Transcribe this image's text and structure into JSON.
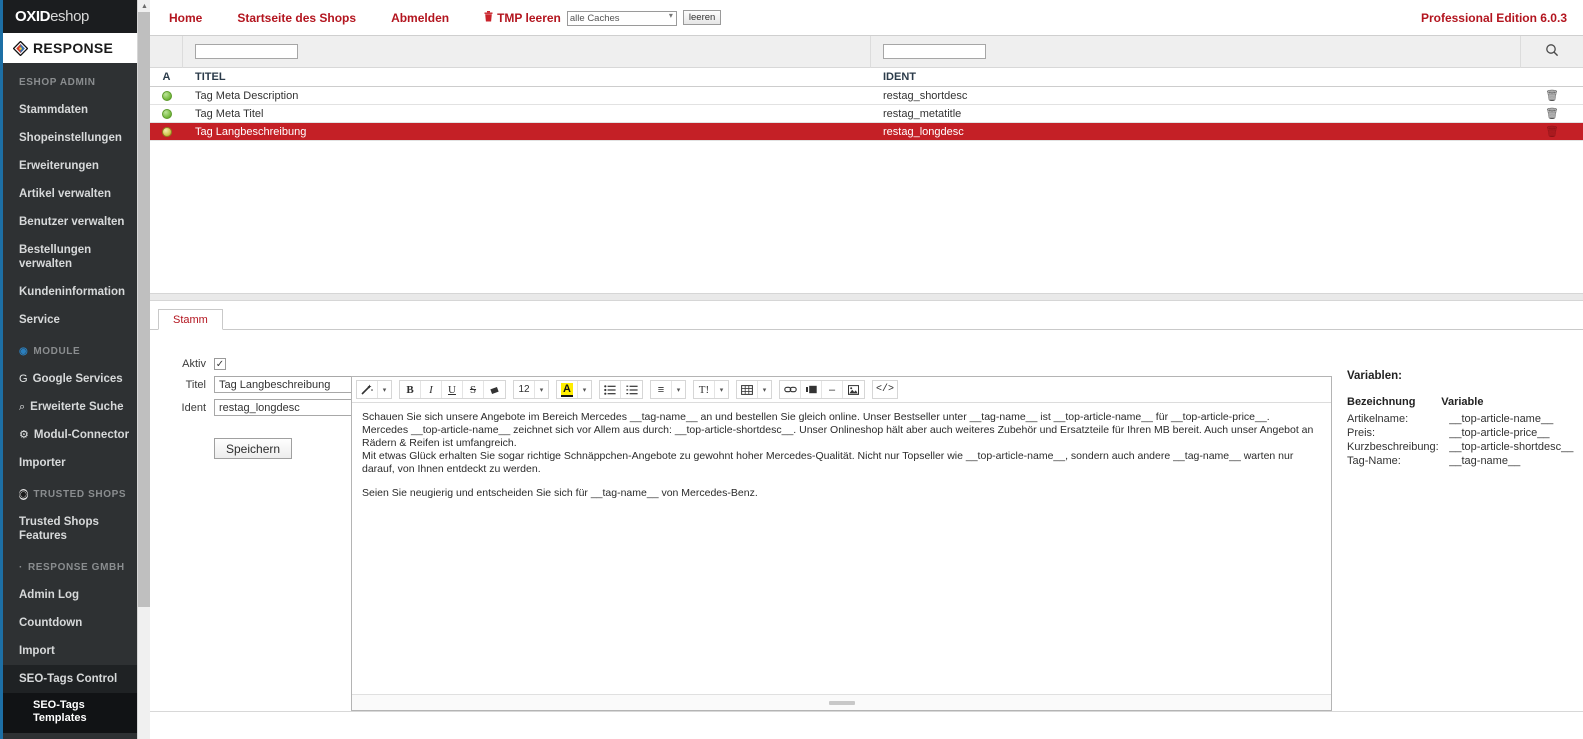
{
  "sidebar": {
    "logo_oxid_bold": "OXID",
    "logo_oxid_light": "eshop",
    "logo_response": "RESPONSE",
    "groups": [
      {
        "label": "ESHOP ADMIN",
        "icon": "",
        "items": [
          {
            "label": "Stammdaten",
            "icon": ""
          },
          {
            "label": "Shopeinstellungen",
            "icon": ""
          },
          {
            "label": "Erweiterungen",
            "icon": ""
          },
          {
            "label": "Artikel verwalten",
            "icon": ""
          },
          {
            "label": "Benutzer verwalten",
            "icon": ""
          },
          {
            "label": "Bestellungen verwalten",
            "icon": ""
          },
          {
            "label": "Kundeninformation",
            "icon": ""
          },
          {
            "label": "Service",
            "icon": ""
          }
        ]
      },
      {
        "label": "MODULE",
        "icon": "◉",
        "items": [
          {
            "label": "Google Services",
            "icon": "G"
          },
          {
            "label": "Erweiterte Suche",
            "icon": "⌕"
          },
          {
            "label": "Modul-Connector",
            "icon": "⚙"
          },
          {
            "label": "Importer",
            "icon": ""
          }
        ]
      },
      {
        "label": "TRUSTED SHOPS",
        "icon": "◉",
        "items": [
          {
            "label": "Trusted Shops Features",
            "icon": ""
          }
        ]
      },
      {
        "label": "RESPONSE GMBH",
        "icon": "·",
        "items": [
          {
            "label": "Admin Log",
            "icon": ""
          },
          {
            "label": "Countdown",
            "icon": ""
          },
          {
            "label": "Import",
            "icon": ""
          },
          {
            "label": "SEO-Tags Control",
            "icon": "",
            "active": true
          }
        ]
      }
    ],
    "sub_item": "SEO-Tags Templates"
  },
  "topbar": {
    "links": [
      "Home",
      "Startseite des Shops",
      "Abmelden"
    ],
    "tmp_label": "TMP leeren",
    "cache_select_value": "alle Caches",
    "clear_button": "leeren",
    "edition": "Professional Edition 6.0.3"
  },
  "list": {
    "filter_titel_value": "",
    "filter_ident_value": "",
    "filter_placeholder": "",
    "search_icon": "search-icon",
    "columns": [
      "A",
      "TITEL",
      "IDENT"
    ],
    "rows": [
      {
        "status": "active",
        "titel": "Tag Meta Description",
        "ident": "restag_shortdesc",
        "selected": false
      },
      {
        "status": "active",
        "titel": "Tag Meta Titel",
        "ident": "restag_metatitle",
        "selected": false
      },
      {
        "status": "active",
        "titel": "Tag Langbeschreibung",
        "ident": "restag_longdesc",
        "selected": true
      }
    ],
    "delete_icon": "🗑"
  },
  "tabs": [
    {
      "label": "Stamm",
      "active": true
    }
  ],
  "form": {
    "aktiv_label": "Aktiv",
    "aktiv_checked": "✓",
    "titel_label": "Titel",
    "titel_value": "Tag Langbeschreibung",
    "ident_label": "Ident",
    "ident_value": "restag_longdesc",
    "save_label": "Speichern"
  },
  "editor": {
    "toolbar_groups": [
      {
        "buttons": [
          {
            "icon": "✨",
            "name": "magic-wand-icon"
          },
          {
            "icon": "▾",
            "name": "chevron-down-icon",
            "caret": true
          }
        ]
      },
      {
        "buttons": [
          {
            "icon": "B",
            "name": "bold-icon",
            "style": "bold-serif"
          },
          {
            "icon": "I",
            "name": "italic-icon",
            "style": "italic-serif"
          },
          {
            "icon": "U",
            "name": "underline-icon",
            "style": "underline-serif"
          },
          {
            "icon": "S",
            "name": "strikethrough-icon",
            "style": "strike-serif"
          },
          {
            "icon": "■",
            "name": "eraser-icon"
          }
        ]
      },
      {
        "buttons": [
          {
            "icon": "12",
            "name": "font-size-selector",
            "style": "size"
          },
          {
            "icon": "▾",
            "name": "chevron-down-icon",
            "caret": true
          }
        ]
      },
      {
        "buttons": [
          {
            "icon": "A",
            "name": "text-color-icon",
            "style": "highlight"
          },
          {
            "icon": "▾",
            "name": "chevron-down-icon",
            "caret": true
          }
        ]
      },
      {
        "buttons": [
          {
            "icon": "☰",
            "name": "unordered-list-icon"
          },
          {
            "icon": "☲",
            "name": "ordered-list-icon"
          }
        ]
      },
      {
        "buttons": [
          {
            "icon": "≡",
            "name": "align-icon"
          },
          {
            "icon": "▾",
            "name": "chevron-down-icon",
            "caret": true
          }
        ]
      },
      {
        "buttons": [
          {
            "icon": "T!",
            "name": "paragraph-style-icon"
          },
          {
            "icon": "▾",
            "name": "chevron-down-icon",
            "caret": true
          }
        ]
      },
      {
        "buttons": [
          {
            "icon": "⊞",
            "name": "table-icon"
          },
          {
            "icon": "▾",
            "name": "chevron-down-icon",
            "caret": true
          }
        ]
      },
      {
        "buttons": [
          {
            "icon": "⚭",
            "name": "link-icon"
          },
          {
            "icon": "▣",
            "name": "insert-block-icon"
          },
          {
            "icon": "–",
            "name": "horizontal-rule-icon"
          },
          {
            "icon": "Ὓc",
            "name": "image-icon"
          }
        ]
      },
      {
        "buttons": [
          {
            "icon": "</>",
            "name": "source-code-icon"
          }
        ]
      }
    ],
    "paragraph1_parts": [
      "Schauen Sie sich unsere Angebote im Bereich Mercedes __tag-name__ an und bestellen Sie gleich online. Unser Bestseller unter __tag-name__ ist __top-article-name__ für __top-article-price__.",
      "Mercedes __top-article-name__ zeichnet sich vor Allem aus durch: __top-article-shortdesc__. Unser Onlineshop hält aber auch weiteres Zubehör und Ersatzteile für Ihren MB bereit. Auch unser Angebot an Rädern & Reifen ist umfangreich.",
      "Mit etwas Glück erhalten Sie sogar richtige Schnäppchen-Angebote zu gewohnt hoher Mercedes-Qualität. Nicht nur Topseller wie __top-article-name__, sondern auch andere __tag-name__ warten nur darauf, von Ihnen entdeckt zu werden."
    ],
    "paragraph2": "Seien Sie neugierig und entscheiden Sie sich für __tag-name__ von Mercedes-Benz.",
    "resize_handle": "resize-grip"
  },
  "variables": {
    "title": "Variablen:",
    "header_name": "Bezeichnung",
    "header_var": "Variable",
    "rows": [
      {
        "name": "Artikelname:",
        "variable": "__top-article-name__"
      },
      {
        "name": "Preis:",
        "variable": "__top-article-price__"
      },
      {
        "name": "Kurzbeschreibung:",
        "variable": "__top-article-shortdesc__"
      },
      {
        "name": "Tag-Name:",
        "variable": "__tag-name__"
      }
    ]
  },
  "colors": {
    "brand_red": "#b3151f",
    "selected_row": "#c42026",
    "sidebar_bg": "#2e3133",
    "accent_blue": "#1d6fa5"
  }
}
